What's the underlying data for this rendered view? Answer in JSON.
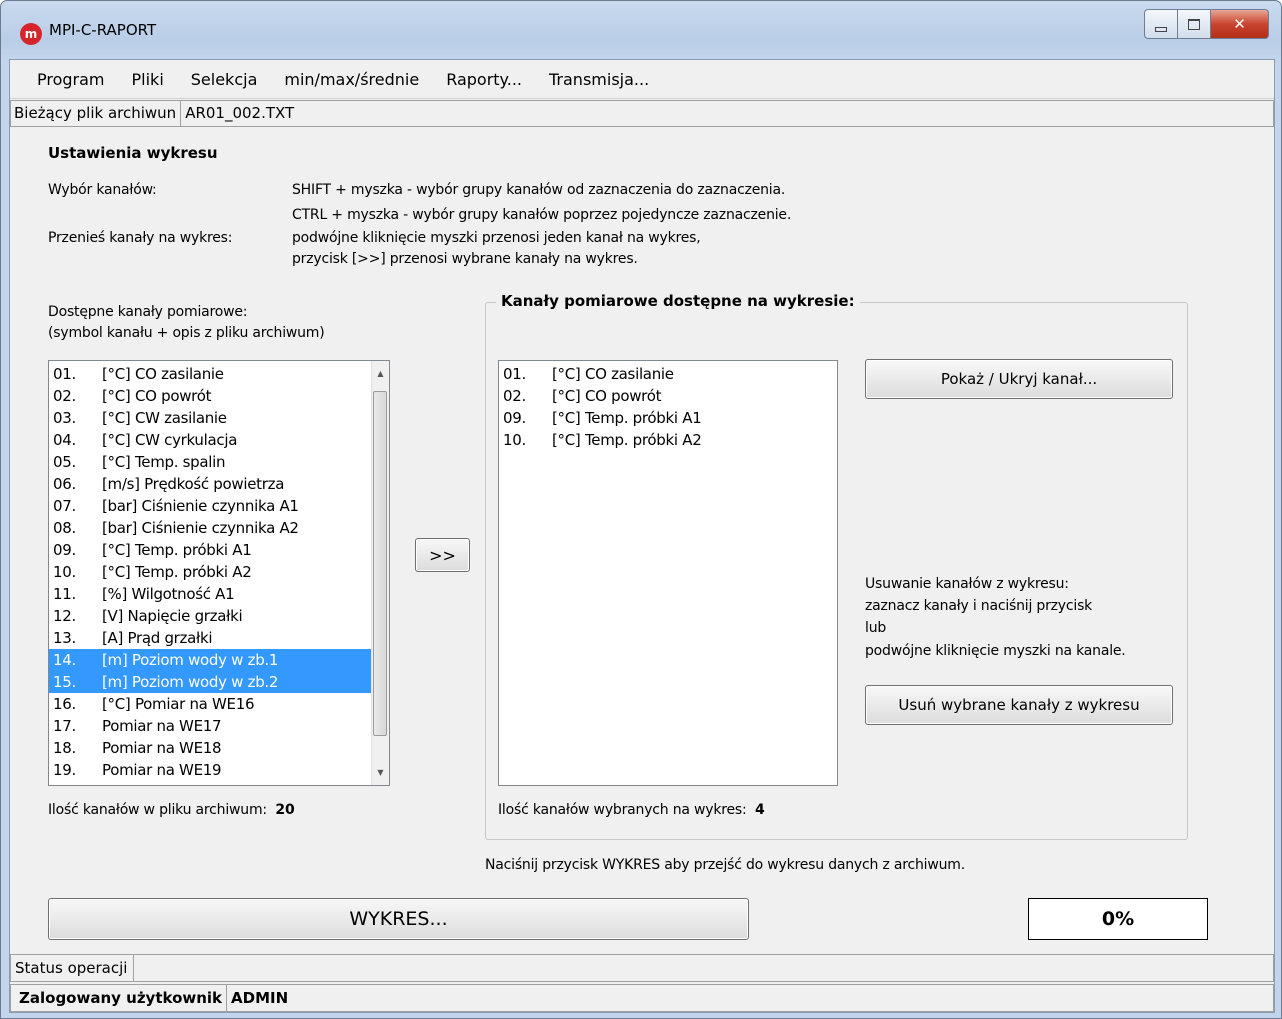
{
  "window": {
    "title": "MPI-C-RAPORT",
    "app_icon": "m"
  },
  "menu": [
    {
      "label": "Program"
    },
    {
      "label": "Pliki"
    },
    {
      "label": "Selekcja"
    },
    {
      "label": "min/max/średnie"
    },
    {
      "label": "Raporty..."
    },
    {
      "label": "Transmisja..."
    }
  ],
  "filebar": {
    "label": "Bieżący plik archiwun",
    "value": "AR01_002.TXT"
  },
  "settings": {
    "heading": "Ustawienia wykresu",
    "channel_select_label": "Wybór kanałów:",
    "channel_select_line1": "SHIFT + myszka - wybór grupy kanałów od zaznaczenia do zaznaczenia.",
    "channel_select_line2": "CTRL + myszka - wybór grupy kanałów poprzez pojedyncze zaznaczenie.",
    "move_label": "Przenieś kanały na wykres:",
    "move_line1": "podwójne kliknięcie myszki przenosi jeden kanał na wykres,",
    "move_line2": "przycisk [>>] przenosi wybrane kanały na wykres."
  },
  "available": {
    "title_line1": "Dostępne kanały pomiarowe:",
    "title_line2": "(symbol kanału + opis z pliku archiwum)",
    "items": [
      {
        "num": "01.",
        "desc": "[°C] CO zasilanie",
        "selected": false
      },
      {
        "num": "02.",
        "desc": "[°C] CO powrót",
        "selected": false
      },
      {
        "num": "03.",
        "desc": "[°C] CW zasilanie",
        "selected": false
      },
      {
        "num": "04.",
        "desc": "[°C] CW cyrkulacja",
        "selected": false
      },
      {
        "num": "05.",
        "desc": "[°C] Temp. spalin",
        "selected": false
      },
      {
        "num": "06.",
        "desc": "[m/s] Prędkość powietrza",
        "selected": false
      },
      {
        "num": "07.",
        "desc": "[bar] Ciśnienie czynnika A1",
        "selected": false
      },
      {
        "num": "08.",
        "desc": "[bar] Ciśnienie czynnika A2",
        "selected": false
      },
      {
        "num": "09.",
        "desc": "[°C] Temp. próbki A1",
        "selected": false
      },
      {
        "num": "10.",
        "desc": "[°C] Temp. próbki A2",
        "selected": false
      },
      {
        "num": "11.",
        "desc": "[%] Wilgotność A1",
        "selected": false
      },
      {
        "num": "12.",
        "desc": "[V] Napięcie grzałki",
        "selected": false
      },
      {
        "num": "13.",
        "desc": "[A] Prąd grzałki",
        "selected": false
      },
      {
        "num": "14.",
        "desc": "[m] Poziom wody w zb.1",
        "selected": true
      },
      {
        "num": "15.",
        "desc": "[m] Poziom wody w zb.2",
        "selected": true
      },
      {
        "num": "16.",
        "desc": "[°C] Pomiar na WE16",
        "selected": false
      },
      {
        "num": "17.",
        "desc": "Pomiar na WE17",
        "selected": false
      },
      {
        "num": "18.",
        "desc": "Pomiar na WE18",
        "selected": false
      },
      {
        "num": "19.",
        "desc": "Pomiar na WE19",
        "selected": false
      }
    ],
    "count_label": "Ilość kanałów w pliku archiwum:",
    "count_value": "20"
  },
  "transfer_button": ">>",
  "chart_group": {
    "title": "Kanały pomiarowe dostępne na wykresie:",
    "items": [
      {
        "num": "01.",
        "desc": "[°C] CO zasilanie"
      },
      {
        "num": "02.",
        "desc": "[°C] CO powrót"
      },
      {
        "num": "09.",
        "desc": "[°C] Temp. próbki A1"
      },
      {
        "num": "10.",
        "desc": "[°C] Temp. próbki A2"
      }
    ],
    "show_hide_button": "Pokaż / Ukryj kanał...",
    "remove_info_line1": "Usuwanie kanałów z wykresu:",
    "remove_info_line2": "zaznacz kanały i naciśnij przycisk",
    "remove_info_line3": "lub",
    "remove_info_line4": "podwójne kliknięcie myszki na kanale.",
    "remove_button": "Usuń wybrane kanały z wykresu",
    "count_label": "Ilość kanałów wybranych na wykres:",
    "count_value": "4"
  },
  "hint": "Naciśnij przycisk WYKRES aby przejść do wykresu danych z archiwum.",
  "chart_button": "WYKRES...",
  "progress": "0%",
  "status": {
    "label": "Status operacji",
    "value": ""
  },
  "user": {
    "label": "Zalogowany użytkownik",
    "value": "ADMIN"
  }
}
